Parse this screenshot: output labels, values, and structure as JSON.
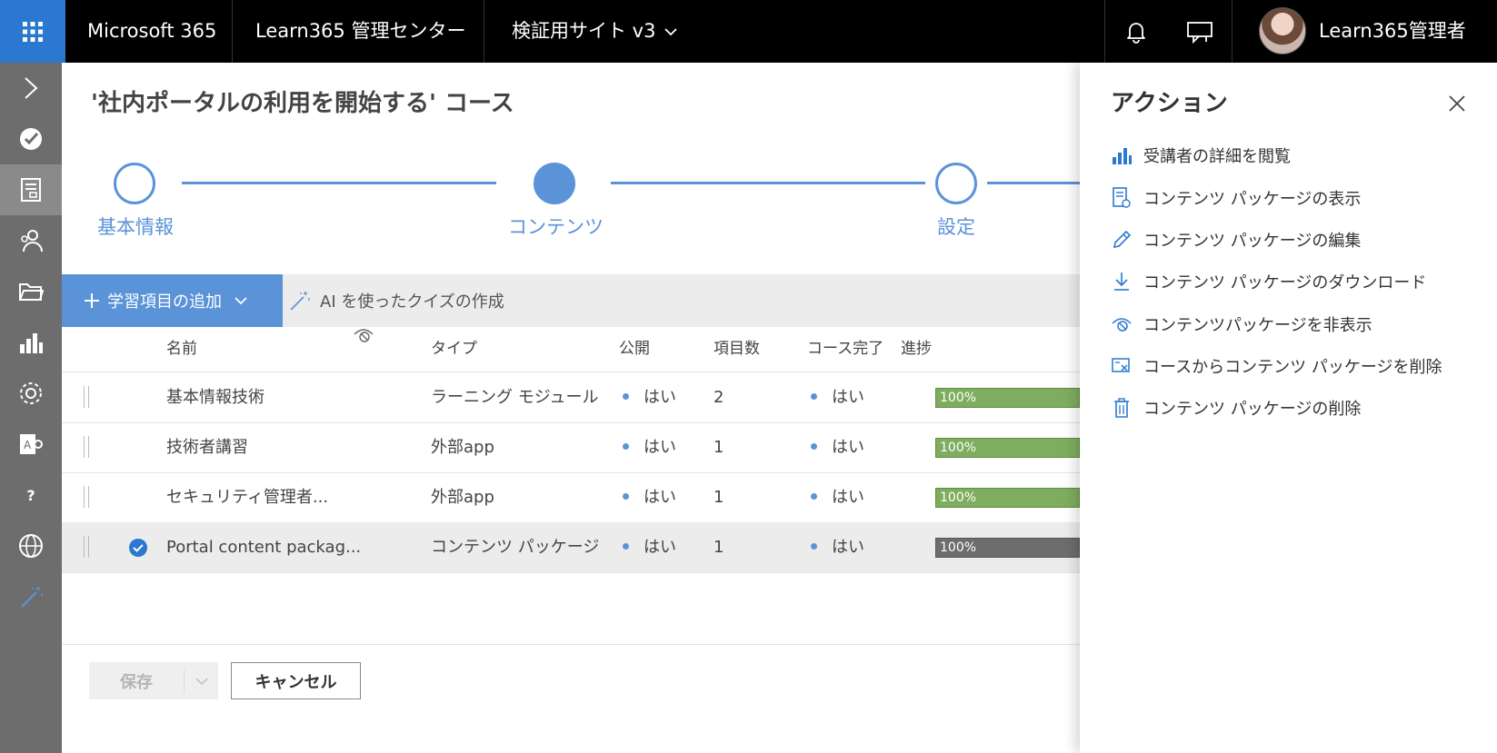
{
  "topbar": {
    "brand": "Microsoft 365",
    "admin_center": "Learn365 管理センター",
    "site": "検証用サイト v3",
    "user_name": "Learn365管理者"
  },
  "page": {
    "title": "'社内ポータルの利用を開始する' コース"
  },
  "steps": [
    {
      "label": "基本情報",
      "state": "inactive"
    },
    {
      "label": "コンテンツ",
      "state": "active"
    },
    {
      "label": "設定",
      "state": "inactive"
    }
  ],
  "toolbar": {
    "add_label": "学習項目の追加",
    "ai_label": "AI を使ったクイズの作成"
  },
  "table": {
    "headers": {
      "name": "名前",
      "type": "タイプ",
      "published": "公開",
      "items": "項目数",
      "course_complete": "コース完了",
      "progress": "進捗"
    },
    "rows": [
      {
        "name": "基本情報技術",
        "type": "ラーニング モジュール",
        "published": "はい",
        "items": "2",
        "complete": "はい",
        "progress": "100%"
      },
      {
        "name": "技術者講習",
        "type": "外部app",
        "published": "はい",
        "items": "1",
        "complete": "はい",
        "progress": "100%"
      },
      {
        "name": "セキュリティ管理者...",
        "type": "外部app",
        "published": "はい",
        "items": "1",
        "complete": "はい",
        "progress": "100%"
      },
      {
        "name": "Portal content packag...",
        "type": "コンテンツ パッケージ",
        "published": "はい",
        "items": "1",
        "complete": "はい",
        "progress": "100%"
      }
    ]
  },
  "footer": {
    "save_label": "保存",
    "cancel_label": "キャンセル"
  },
  "panel": {
    "title": "アクション",
    "actions": [
      {
        "label": "受講者の詳細を閲覧",
        "icon": "bar-chart-icon"
      },
      {
        "label": "コンテンツ パッケージの表示",
        "icon": "document-view-icon"
      },
      {
        "label": "コンテンツ パッケージの編集",
        "icon": "pencil-icon"
      },
      {
        "label": "コンテンツ パッケージのダウンロード",
        "icon": "download-icon"
      },
      {
        "label": "コンテンツパッケージを非表示",
        "icon": "hide-icon"
      },
      {
        "label": "コースからコンテンツ パッケージを削除",
        "icon": "remove-from-course-icon"
      },
      {
        "label": "コンテンツ パッケージの削除",
        "icon": "trash-icon"
      }
    ]
  },
  "colors": {
    "accent": "#5b93d9",
    "waffle": "#2b78d0",
    "progress_green": "#7fad5f",
    "rail": "#6d6d6d"
  }
}
